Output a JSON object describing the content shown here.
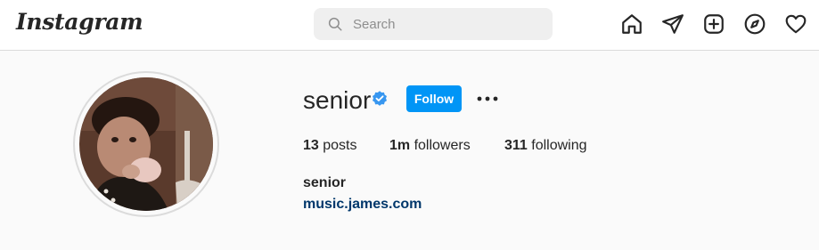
{
  "header": {
    "logo": "Instagram",
    "search": {
      "placeholder": "Search"
    },
    "nav_icons": [
      "home-icon",
      "direct-message-icon",
      "new-post-icon",
      "explore-icon",
      "activity-heart-icon"
    ]
  },
  "profile": {
    "username": "senior",
    "verified": true,
    "follow_label": "Follow",
    "stats": {
      "posts_count": "13",
      "posts_label": "posts",
      "followers_count": "1m",
      "followers_label": "followers",
      "following_count": "311",
      "following_label": "following"
    },
    "full_name": "senior",
    "website": "music.james.com"
  },
  "colors": {
    "follow_button": "#0095f6",
    "verified_badge": "#3897f0",
    "link": "#00376b",
    "page_background": "#fafafa"
  }
}
